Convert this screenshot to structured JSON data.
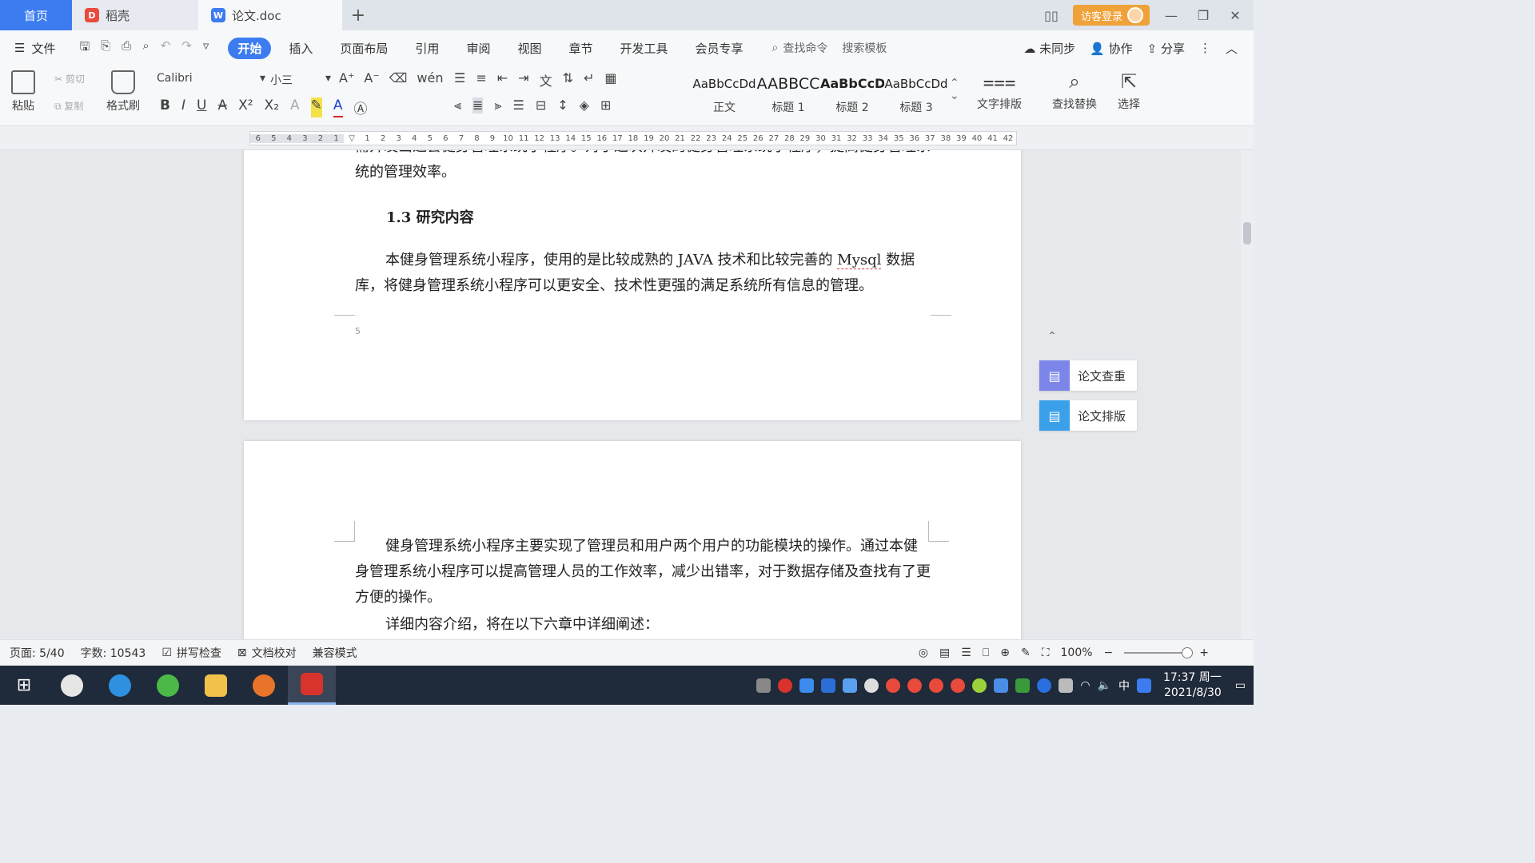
{
  "tabs": {
    "home": "首页",
    "daoke": "稻壳",
    "doc": "论文.doc",
    "add": "+",
    "login": "访客登录"
  },
  "menu": {
    "file": "文件",
    "items": [
      "开始",
      "插入",
      "页面布局",
      "引用",
      "审阅",
      "视图",
      "章节",
      "开发工具",
      "会员专享"
    ],
    "active": "开始",
    "search_cmd": "查找命令",
    "search_tpl": "搜索模板",
    "unsync": "未同步",
    "collab": "协作",
    "share": "分享"
  },
  "ribbon": {
    "paste": "粘贴",
    "cut": "剪切",
    "copy": "复制",
    "format_painter": "格式刷",
    "font_name": "Calibri",
    "font_size": "小三",
    "styles": [
      {
        "sample": "AaBbCcDd",
        "label": "正文"
      },
      {
        "sample": "AABBCC",
        "label": "标题 1"
      },
      {
        "sample": "AaBbCcD",
        "label": "标题 2"
      },
      {
        "sample": "AaBbCcDd",
        "label": "标题 3"
      }
    ],
    "text_layout": "文字排版",
    "find_replace": "查找替换",
    "select": "选择"
  },
  "ruler": {
    "left_ticks": [
      "6",
      "5",
      "4",
      "3",
      "2",
      "1"
    ],
    "ticks": [
      "1",
      "2",
      "3",
      "4",
      "5",
      "6",
      "7",
      "8",
      "9",
      "10",
      "11",
      "12",
      "13",
      "14",
      "15",
      "16",
      "17",
      "18",
      "19",
      "20",
      "21",
      "22",
      "23",
      "24",
      "25",
      "26",
      "27",
      "28",
      "29",
      "30",
      "31",
      "32",
      "33",
      "34",
      "35",
      "36",
      "37",
      "38",
      "39",
      "40",
      "41",
      "42"
    ]
  },
  "document": {
    "p0": "需开发出这套健身管理系统小程序。对于这次开发的健身管理系统小程序，提高健身管理系统的管理效率。",
    "heading_num": "1.3",
    "heading_text": "研究内容",
    "p1_a": "本健身管理系统小程序，使用的是比较成熟的 JAVA 技术和比较完善的 ",
    "p1_mysql": "Mysql",
    "p1_b": " 数据库，将健身管理系统小程序可以更安全、技术性更强的满足系统所有信息的管理。",
    "page_num": "5",
    "p2": "健身管理系统小程序主要实现了管理员和用户两个用户的功能模块的操作。通过本健身管理系统小程序可以提高管理人员的工作效率，减少出错率，对于数据存储及查找有了更方便的操作。",
    "p3": "详细内容介绍，将在以下六章中详细阐述："
  },
  "side_panel": {
    "check": "论文查重",
    "format": "论文排版"
  },
  "status": {
    "page": "页面: 5/40",
    "words": "字数: 10543",
    "spell": "拼写检查",
    "proof": "文档校对",
    "compat": "兼容模式",
    "zoom": "100%"
  },
  "taskbar": {
    "time": "17:37 周一",
    "date": "2021/8/30",
    "ime": "中"
  },
  "colors": {
    "accent": "#3c7cf0",
    "login": "#f0a23a",
    "taskbar": "#1f2a3a",
    "side_icon": "#5b8ef0"
  }
}
